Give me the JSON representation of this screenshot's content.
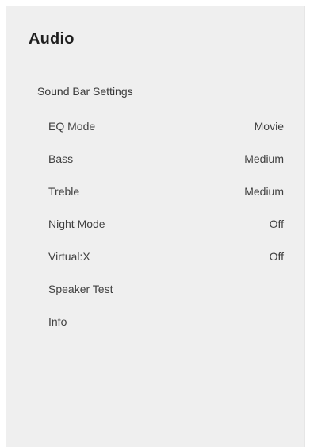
{
  "panel": {
    "title": "Audio",
    "section_label": "Sound Bar Settings",
    "items": [
      {
        "label": "EQ Mode",
        "value": "Movie"
      },
      {
        "label": "Bass",
        "value": "Medium"
      },
      {
        "label": "Treble",
        "value": "Medium"
      },
      {
        "label": "Night Mode",
        "value": "Off"
      },
      {
        "label": "Virtual:X",
        "value": "Off"
      },
      {
        "label": "Speaker Test",
        "value": ""
      },
      {
        "label": "Info",
        "value": ""
      }
    ]
  }
}
